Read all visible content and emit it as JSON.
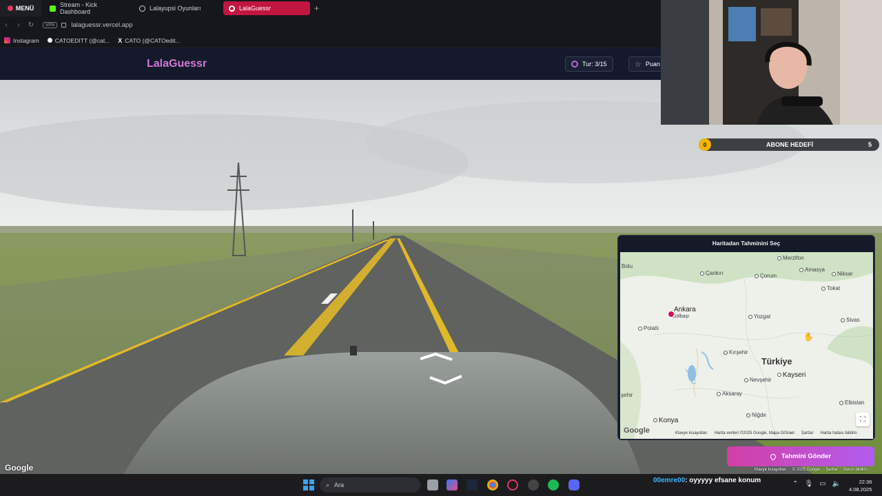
{
  "browser": {
    "menu_label": "MENÜ",
    "tabs": [
      {
        "label": "Stream - Kick Dashboard"
      },
      {
        "label": "Lalayupsi Oyunları"
      },
      {
        "label": "LalaGuessr"
      }
    ],
    "new_tab": "+",
    "vpn_label": "VPN",
    "url": "lalaguessr.vercel.app",
    "bookmarks": [
      {
        "label": "Instagram"
      },
      {
        "label": "CATOEDITT (@cat..."
      },
      {
        "label": "CATO (@CATOedit..."
      }
    ]
  },
  "app": {
    "brand": "LalaGuessr",
    "round_label": "Tur: 3/15",
    "score_label": "Puan"
  },
  "streetview": {
    "google_label": "Google",
    "footer": [
      "Klavye kısayolları",
      "© 2025 Google",
      "Şartlar",
      "Sorun bildirin"
    ]
  },
  "overlay": {
    "sub_goal": {
      "current": "0",
      "label": "ABONE HEDEFİ",
      "target": "5",
      "progress": 0
    }
  },
  "map_panel": {
    "title": "Haritadan Tahminini Seç",
    "country": "Türkiye",
    "cities": [
      {
        "name": "Merzifon"
      },
      {
        "name": "Çankırı"
      },
      {
        "name": "Çorum"
      },
      {
        "name": "Amasya"
      },
      {
        "name": "Niksar"
      },
      {
        "name": "Tokat"
      },
      {
        "name": "Bolu"
      },
      {
        "name": "Ankara"
      },
      {
        "name": "Gölbaşı"
      },
      {
        "name": "Polatlı"
      },
      {
        "name": "Yozgat"
      },
      {
        "name": "Sivas"
      },
      {
        "name": "Kırşehir"
      },
      {
        "name": "Kayseri"
      },
      {
        "name": "Nevşehir"
      },
      {
        "name": "Aksaray"
      },
      {
        "name": "Niğde"
      },
      {
        "name": "Konya"
      },
      {
        "name": "Elbistan"
      },
      {
        "name": "şehir"
      }
    ],
    "google_label": "Google",
    "footer": [
      "Klavye kısayolları",
      "Harita verileri ©2025 Google, Mapa GISrael",
      "Şartlar",
      "Harita hatası bildirin"
    ],
    "submit_label": "Tahmini Gönder"
  },
  "taskbar": {
    "search_placeholder": "Ara",
    "chat_user": "00emre00",
    "chat_message": ": oyyyyy efsane konum",
    "time": "22:36",
    "date": "4.08.2025"
  },
  "colors": {
    "active_tab": "#c2153f",
    "brand": "#d377d8",
    "map_pin": "#d10f5e",
    "submit_gradient_start": "#d23fa3",
    "submit_gradient_end": "#b25cf0",
    "sub_goal_badge": "#f4b400"
  }
}
